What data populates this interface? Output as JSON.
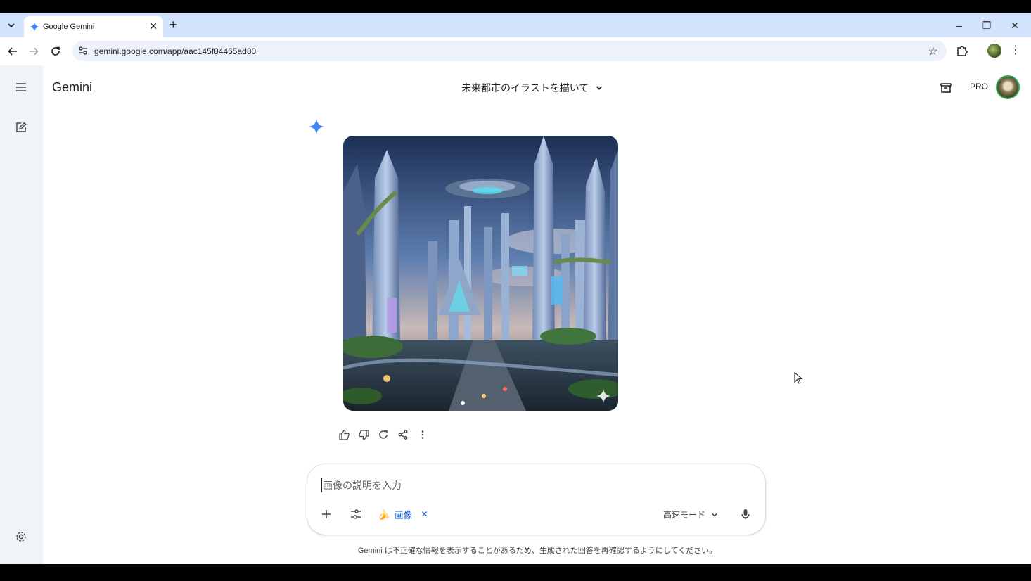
{
  "browser": {
    "tab_title": "Google Gemini",
    "url": "gemini.google.com/app/aac145f84465ad80",
    "window_controls": {
      "minimize": "–",
      "restore": "❐",
      "close": "✕"
    }
  },
  "app": {
    "brand": "Gemini",
    "conversation_title": "未来都市のイラストを描いて",
    "pro_label": "PRO"
  },
  "response": {
    "image_alt": "未来都市のイラスト"
  },
  "input": {
    "placeholder": "画像の説明を入力",
    "tool_chip_label": "画像",
    "tool_chip_emoji": "🍌",
    "mode_label": "高速モード"
  },
  "disclaimer": "Gemini は不正確な情報を表示することがあるため、生成された回答を再確認するようにしてください。",
  "colors": {
    "tabstrip": "#d3e3fd",
    "sidebar": "#f0f4f9",
    "accent": "#0b57d0",
    "gemini_spark": "#4285f4"
  }
}
